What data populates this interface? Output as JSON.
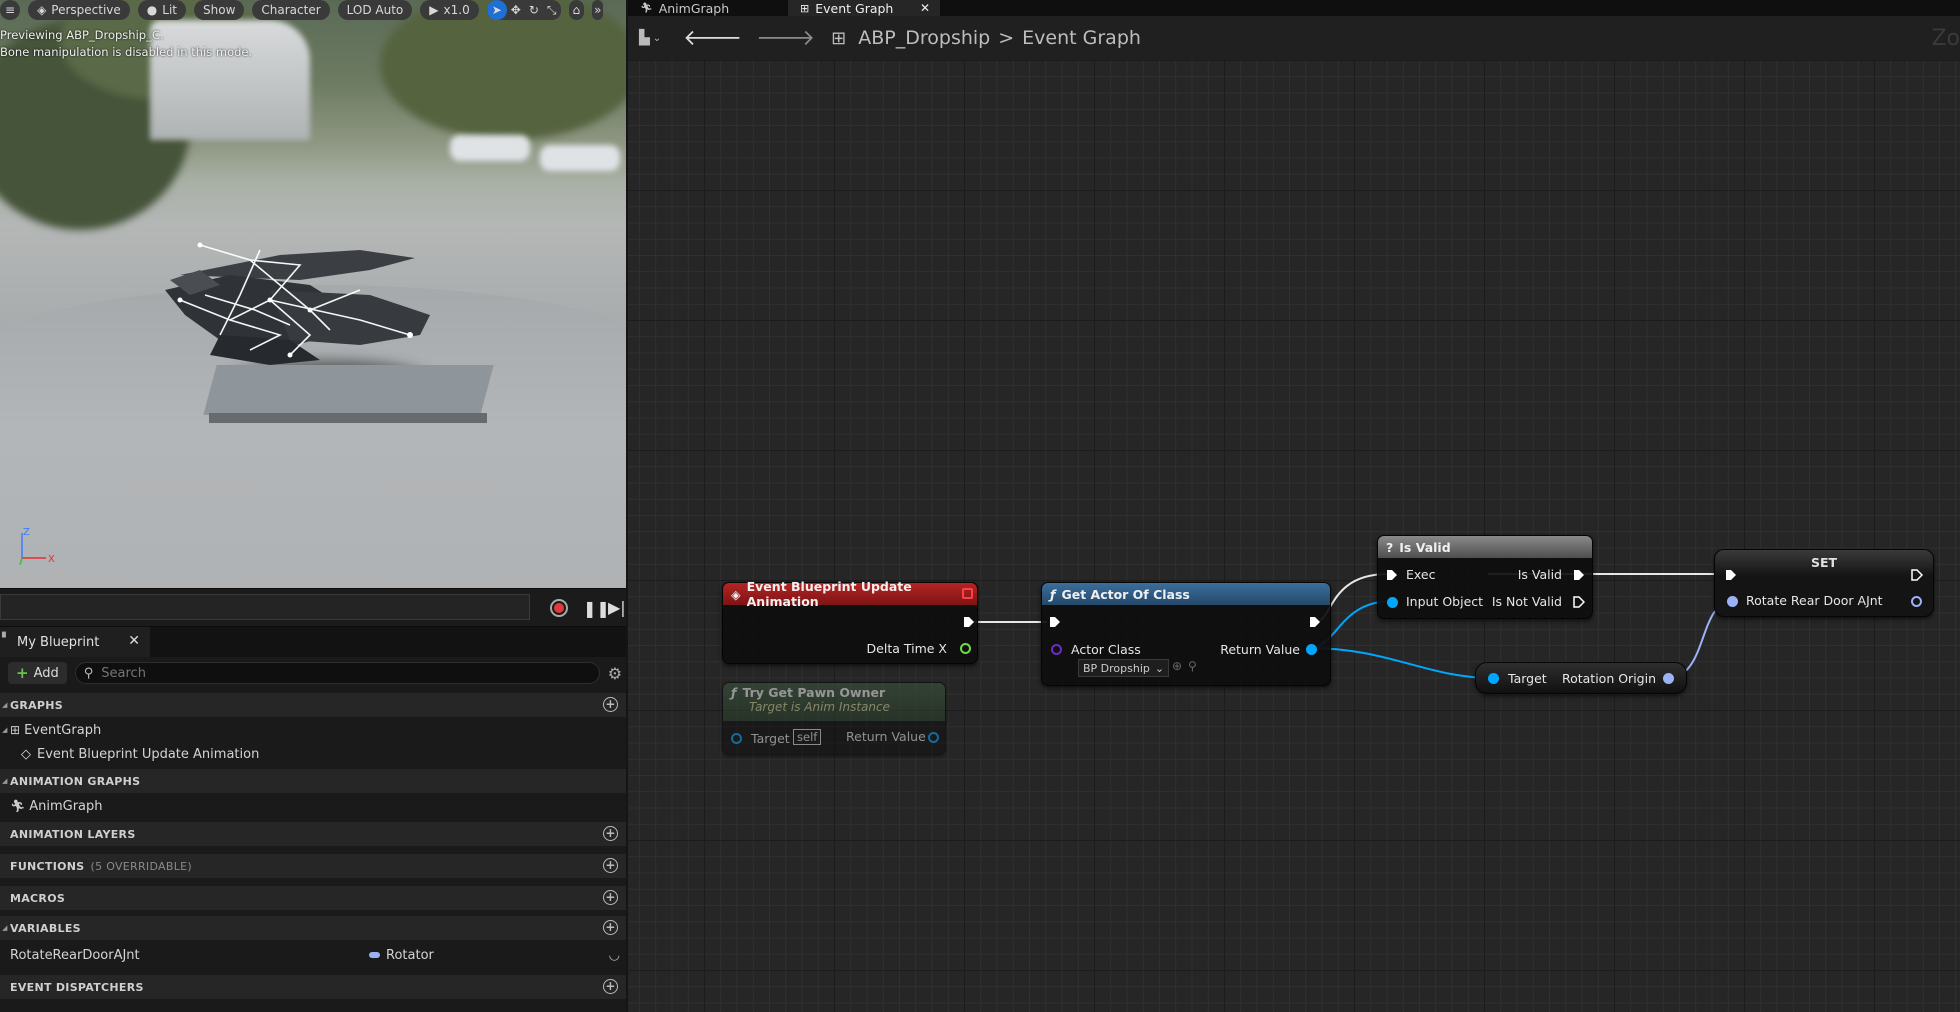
{
  "viewport": {
    "toolbar": {
      "menu_icon": "hamburger-icon",
      "perspective": "Perspective",
      "lit": "Lit",
      "show": "Show",
      "character": "Character",
      "lod": "LOD Auto",
      "speed": "x1.0"
    },
    "info_line1": "Previewing ABP_Dropship_C.",
    "info_line2": "Bone manipulation is disabled in this mode.",
    "axis_z": "Z",
    "axis_x": "X"
  },
  "my_blueprint": {
    "tab_label": "My Blueprint",
    "add_label": "Add",
    "search_placeholder": "Search",
    "sections": {
      "graphs": "GRAPHS",
      "animation_graphs": "ANIMATION GRAPHS",
      "animation_layers": "ANIMATION LAYERS",
      "functions": "FUNCTIONS",
      "functions_sub": "(5 OVERRIDABLE)",
      "macros": "MACROS",
      "variables": "VARIABLES",
      "event_dispatchers": "EVENT DISPATCHERS"
    },
    "graphs_items": {
      "event_graph": "EventGraph",
      "event_update": "Event Blueprint Update Animation"
    },
    "anim_graph": "AnimGraph",
    "variable": {
      "name": "RotateRearDoorAJnt",
      "type": "Rotator",
      "type_color": "#9cb2f7"
    }
  },
  "graph_editor": {
    "tabs": {
      "anim": "AnimGraph",
      "event": "Event Graph"
    },
    "breadcrumb": {
      "blueprint": "ABP_Dropship",
      "separator": ">",
      "graph": "Event Graph"
    },
    "partial_zoom": "Zo",
    "nodes": {
      "event_update": {
        "title": "Event Blueprint Update Animation",
        "pin_delta": "Delta Time X",
        "head_color": "#9c1c1c"
      },
      "try_get_pawn": {
        "title": "Try Get Pawn Owner",
        "subtitle": "Target is Anim Instance",
        "pin_target": "Target",
        "target_default": "self",
        "pin_return": "Return Value"
      },
      "get_actor": {
        "title": "Get Actor Of Class",
        "pin_class": "Actor Class",
        "class_value": "BP Dropship",
        "pin_return": "Return Value",
        "head_color": "#2a5a86"
      },
      "is_valid": {
        "title": "Is Valid",
        "pin_exec": "Exec",
        "pin_input": "Input Object",
        "pin_valid": "Is Valid",
        "pin_not_valid": "Is Not Valid"
      },
      "rotation_origin": {
        "pin_target": "Target",
        "pin_out": "Rotation Origin"
      },
      "set": {
        "title": "SET",
        "pin_var": "Rotate Rear Door AJnt"
      }
    },
    "colors": {
      "object_pin": "#00a6ff",
      "rotator_pin": "#9cb2f7",
      "float_pin": "#71d84d",
      "class_pin": "#6c2dbf"
    }
  }
}
